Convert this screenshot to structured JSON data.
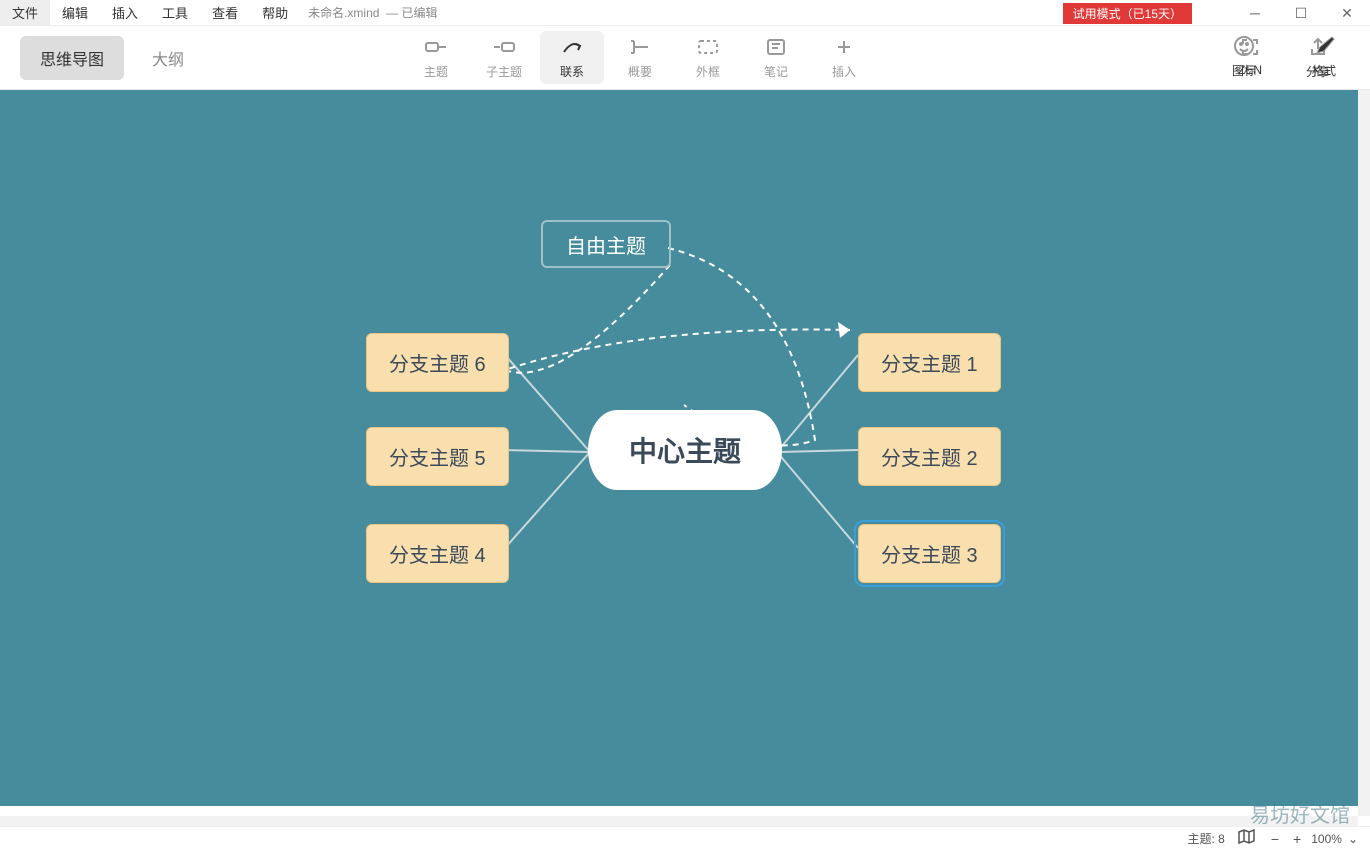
{
  "menubar": {
    "items": [
      "文件",
      "编辑",
      "插入",
      "工具",
      "查看",
      "帮助"
    ]
  },
  "document": {
    "title": "未命名.xmind",
    "status": "— 已编辑"
  },
  "trial": {
    "label": "试用模式（已15天）"
  },
  "view_tabs": {
    "mindmap": "思维导图",
    "outline": "大纲"
  },
  "toolbar": {
    "topic": "主题",
    "subtopic": "子主题",
    "relation": "联系",
    "summary": "概要",
    "boundary": "外框",
    "note": "笔记",
    "insert": "插入",
    "zen": "ZEN",
    "share": "分享",
    "icons": "图标",
    "format": "格式"
  },
  "mindmap": {
    "central": "中心主题",
    "floating": "自由主题",
    "branches": [
      "分支主题 1",
      "分支主题 2",
      "分支主题 3",
      "分支主题 4",
      "分支主题 5",
      "分支主题 6"
    ]
  },
  "statusbar": {
    "topic_count_label": "主题:",
    "topic_count": "8",
    "zoom": "100%"
  },
  "watermark": "易坊好文馆"
}
